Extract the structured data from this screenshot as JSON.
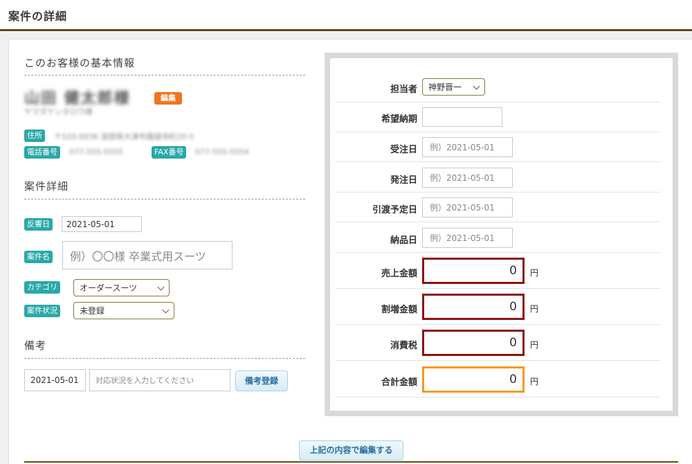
{
  "page": {
    "title": "案件の詳細"
  },
  "customer": {
    "section_title": "このお客様の基本情報",
    "name": "山田 健太郎様",
    "kana": "ヤマダケンタロウ様",
    "edit_label": "編集",
    "address_tag": "住所",
    "address": "〒520-0036 滋賀県大津市園城寺町20-5",
    "phone_tag": "電話番号",
    "phone": "077-555-5555",
    "fax_tag": "FAX番号",
    "fax": "077-555-5554"
  },
  "case": {
    "section_title": "案件詳細",
    "response_date_tag": "反響日",
    "response_date": "2021-05-01",
    "case_name_tag": "案件名",
    "case_name_placeholder": "例）〇〇様 卒業式用スーツ",
    "category_tag": "カテゴリ",
    "category_value": "オーダースーツ",
    "status_tag": "案件状況",
    "status_value": "未登録"
  },
  "notes": {
    "section_title": "備考",
    "date_value": "2021-05-01",
    "text_placeholder": "対応状況を入力してください",
    "register_button": "備考登録"
  },
  "details": {
    "staff_label": "担当者",
    "staff_value": "神野晋一",
    "desired_delivery_label": "希望納期",
    "order_date_label": "受注日",
    "order_date_placeholder": "例）2021-05-01",
    "ship_date_label": "発注日",
    "ship_date_placeholder": "例）2021-05-01",
    "handover_label": "引渡予定日",
    "handover_placeholder": "例）2021-05-01",
    "delivery_label": "納品日",
    "delivery_placeholder": "例）2021-05-01",
    "sales_label": "売上金額",
    "sales_value": "0",
    "surcharge_label": "割増金額",
    "surcharge_value": "0",
    "tax_label": "消費税",
    "tax_value": "0",
    "total_label": "合計金額",
    "total_value": "0",
    "yen": "円"
  },
  "actions": {
    "edit_button": "上記の内容で編集する"
  },
  "colors": {
    "accent_dark": "#5b4d1c",
    "tag_teal": "#2aa8a8",
    "edit_orange": "#f07421",
    "amount_red": "#8c1212",
    "total_orange": "#f29a1b"
  }
}
